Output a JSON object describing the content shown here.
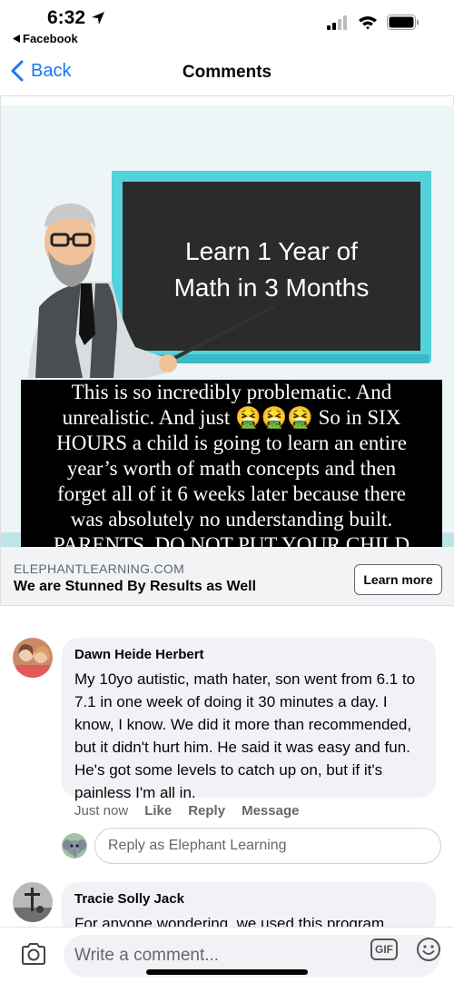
{
  "status_bar": {
    "time": "6:32",
    "back_app_label": "Facebook"
  },
  "nav": {
    "back_label": "Back",
    "title": "Comments"
  },
  "ad": {
    "board_line1": "Learn 1 Year of",
    "board_line2": "Math in 3 Months",
    "overlay_lines": [
      "This is so incredibly problematic. And",
      "unrealistic. And just 🤮🤮🤮 So in SIX",
      "HOURS a child is going to learn an entire",
      "year’s worth of math concepts and then",
      "forget all of it 6 weeks later because there",
      "was absolutely no understanding built.",
      "PARENTS, DO NOT PUT YOUR CHILD"
    ],
    "domain": "ELEPHANTLEARNING.COM",
    "headline": "We are Stunned By Results as Well",
    "cta": "Learn more"
  },
  "comments": [
    {
      "author": "Dawn Heide Herbert",
      "text": "My 10yo autistic, math hater, son went from 6.1 to 7.1 in one week of doing it 30 minutes a day. I know, I know. We did it more than recommended, but it didn't hurt him. He said it was easy and fun. He's got some levels to catch up on, but if it's painless I'm all in.",
      "time": "Just now",
      "actions": [
        "Like",
        "Reply",
        "Message"
      ]
    },
    {
      "author": "Tracie Solly Jack",
      "text": "For anyone wondering, we used this program,"
    }
  ],
  "reply": {
    "placeholder": "Reply as Elephant Learning"
  },
  "composer": {
    "placeholder": "Write a comment...",
    "gif_label": "GIF"
  },
  "icons": {
    "location": "location-arrow-icon",
    "signal": "signal-icon",
    "wifi": "wifi-icon",
    "battery": "battery-icon",
    "camera": "camera-icon",
    "emoji": "emoji-icon"
  },
  "colors": {
    "accent": "#1877f2",
    "bubble": "#f0f2f5",
    "secondary_text": "#65676b"
  }
}
